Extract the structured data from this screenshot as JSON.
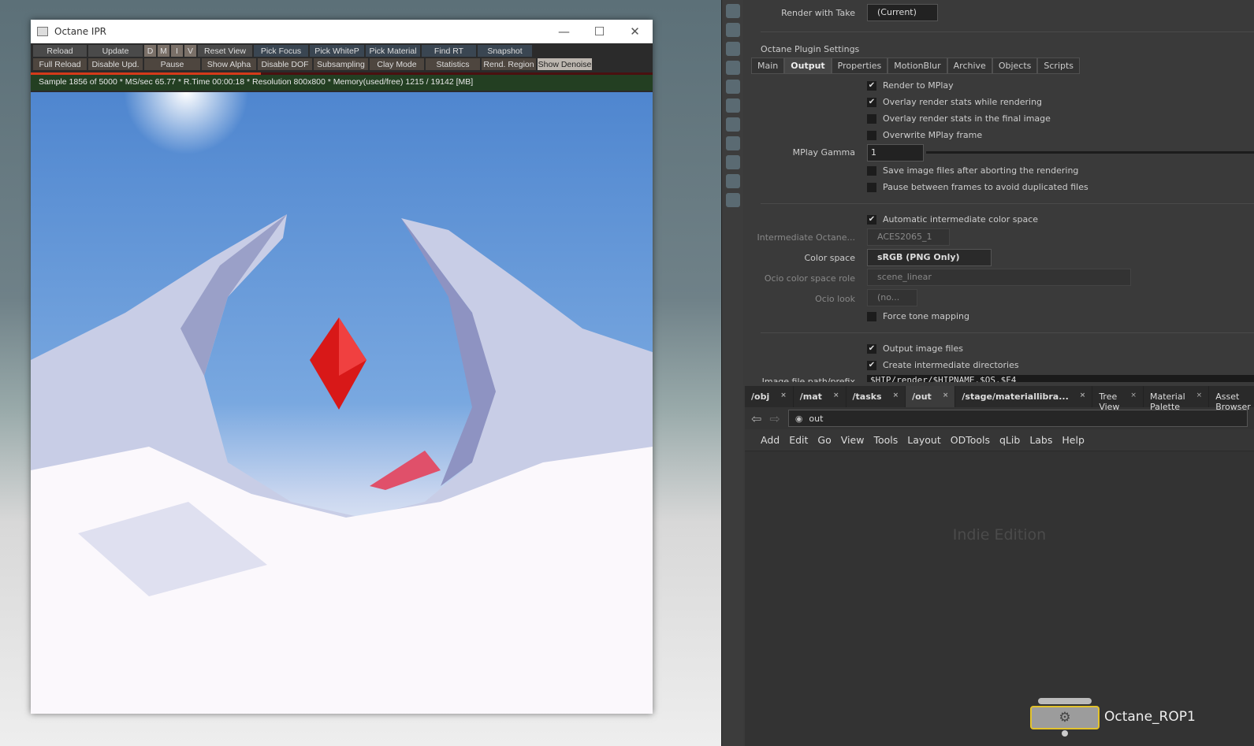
{
  "ipr": {
    "title": "Octane IPR",
    "row1": [
      "Reload",
      "Update",
      "D",
      "M",
      "I",
      "V",
      "Reset View",
      "Pick Focus",
      "Pick WhiteP",
      "Pick Material",
      "Find RT",
      "Snapshot"
    ],
    "row2": [
      "Full Reload",
      "Disable Upd.",
      "Pause",
      "Show Alpha",
      "Disable DOF",
      "Subsampling",
      "Clay Mode",
      "Statistics",
      "Rend. Region",
      "Show Denoise"
    ],
    "progress": 0.37,
    "status": "Sample 1856 of 5000 * MS/sec 65.77 * R.Time 00:00:18 * Resolution 800x800 * Memory(used/free) 1215 / 19142 [MB]"
  },
  "params": {
    "render_with_take_label": "Render with Take",
    "render_with_take_value": "(Current)",
    "section": "Octane Plugin Settings",
    "tabs": [
      "Main",
      "Output",
      "Properties",
      "MotionBlur",
      "Archive",
      "Objects",
      "Scripts"
    ],
    "active_tab": "Output",
    "checks1": [
      {
        "label": "Render to MPlay",
        "checked": true
      },
      {
        "label": "Overlay render stats while rendering",
        "checked": true
      },
      {
        "label": "Overlay render stats in the final image",
        "checked": false
      },
      {
        "label": "Overwrite MPlay frame",
        "checked": false
      }
    ],
    "gamma_label": "MPlay Gamma",
    "gamma_value": "1",
    "checks2": [
      {
        "label": "Save image files after aborting the rendering",
        "checked": false
      },
      {
        "label": "Pause between frames to avoid duplicated files",
        "checked": false
      }
    ],
    "auto_cs": "Automatic intermediate color space",
    "inter_label": "Intermediate Octane...",
    "inter_value": "ACES2065_1",
    "cs_label": "Color space",
    "cs_value": "sRGB (PNG Only)",
    "ocio_role_label": "Ocio color space role",
    "ocio_role_value": "scene_linear",
    "ocio_look_label": "Ocio look",
    "ocio_look_value": "(no...",
    "force_tone": "Force tone mapping",
    "output_files": "Output image files",
    "create_dirs": "Create intermediate directories",
    "path_label": "Image file path/prefix",
    "path_value": "$HIP/render/$HIPNAME.$OS.$F4"
  },
  "network": {
    "tabs": [
      "/obj",
      "/mat",
      "/tasks",
      "/out",
      "/stage/materiallibra...",
      "Tree View",
      "Material Palette",
      "Asset Browser"
    ],
    "active_tab": "/out",
    "path": "out",
    "menu": [
      "Add",
      "Edit",
      "Go",
      "View",
      "Tools",
      "Layout",
      "ODTools",
      "qLib",
      "Labs",
      "Help"
    ],
    "watermark": "Indie Edition",
    "node_label": "Octane_ROP1"
  },
  "colors": {
    "accent_node": "#e3c32c",
    "status_bar": "#233f22",
    "progress": "#d43a1a"
  }
}
